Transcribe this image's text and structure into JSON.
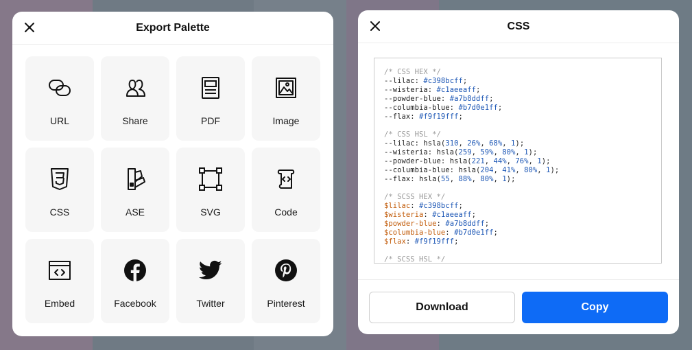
{
  "export_panel": {
    "title": "Export Palette",
    "tiles": [
      {
        "label": "URL",
        "icon": "link-icon"
      },
      {
        "label": "Share",
        "icon": "users-icon"
      },
      {
        "label": "PDF",
        "icon": "pdf-icon"
      },
      {
        "label": "Image",
        "icon": "image-icon"
      },
      {
        "label": "CSS",
        "icon": "css3-icon"
      },
      {
        "label": "ASE",
        "icon": "swatch-icon"
      },
      {
        "label": "SVG",
        "icon": "vector-icon"
      },
      {
        "label": "Code",
        "icon": "code-scroll-icon"
      },
      {
        "label": "Embed",
        "icon": "embed-icon"
      },
      {
        "label": "Facebook",
        "icon": "facebook-icon"
      },
      {
        "label": "Twitter",
        "icon": "twitter-icon"
      },
      {
        "label": "Pinterest",
        "icon": "pinterest-icon"
      }
    ]
  },
  "css_panel": {
    "title": "CSS",
    "sections": [
      {
        "comment": "/* CSS HEX */",
        "style": "css",
        "lines": [
          {
            "name": "--lilac",
            "value": "#c398bcff"
          },
          {
            "name": "--wisteria",
            "value": "#c1aeeaff"
          },
          {
            "name": "--powder-blue",
            "value": "#a7b8ddff"
          },
          {
            "name": "--columbia-blue",
            "value": "#b7d0e1ff"
          },
          {
            "name": "--flax",
            "value": "#f9f19fff"
          }
        ]
      },
      {
        "comment": "/* CSS HSL */",
        "style": "css-hsl",
        "lines": [
          {
            "name": "--lilac",
            "hsla": [
              "310",
              "26%",
              "68%",
              "1"
            ]
          },
          {
            "name": "--wisteria",
            "hsla": [
              "259",
              "59%",
              "80%",
              "1"
            ]
          },
          {
            "name": "--powder-blue",
            "hsla": [
              "221",
              "44%",
              "76%",
              "1"
            ]
          },
          {
            "name": "--columbia-blue",
            "hsla": [
              "204",
              "41%",
              "80%",
              "1"
            ]
          },
          {
            "name": "--flax",
            "hsla": [
              "55",
              "88%",
              "80%",
              "1"
            ]
          }
        ]
      },
      {
        "comment": "/* SCSS HEX */",
        "style": "scss",
        "lines": [
          {
            "name": "$lilac",
            "value": "#c398bcff"
          },
          {
            "name": "$wisteria",
            "value": "#c1aeeaff"
          },
          {
            "name": "$powder-blue",
            "value": "#a7b8ddff"
          },
          {
            "name": "$columbia-blue",
            "value": "#b7d0e1ff"
          },
          {
            "name": "$flax",
            "value": "#f9f19fff"
          }
        ]
      },
      {
        "comment": "/* SCSS HSL */",
        "style": "comment-only",
        "lines": []
      }
    ],
    "download_label": "Download",
    "copy_label": "Copy"
  },
  "colors": {
    "accent": "#0e6bf6",
    "code_value": "#1d57b5",
    "scss_var": "#c25c0a",
    "comment": "#9a9a9a"
  }
}
